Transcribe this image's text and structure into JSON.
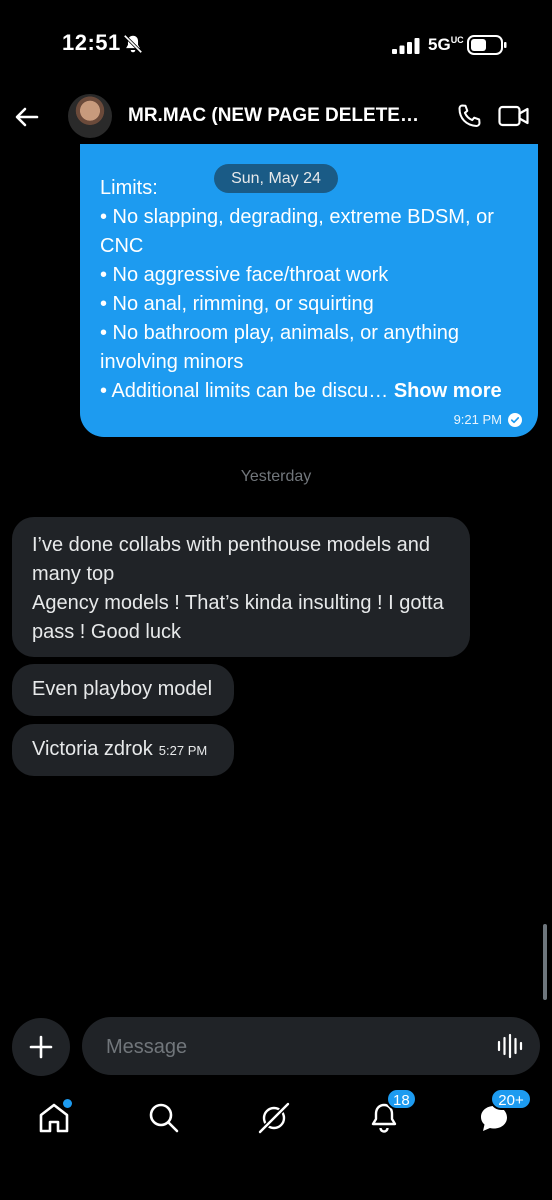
{
  "status_bar": {
    "time": "12:51",
    "network": "5G",
    "network_sup": "UC"
  },
  "header": {
    "contact_name": "MR.MAC (NEW PAGE DELETED...",
    "icons": [
      "back-arrow-icon",
      "phone-icon",
      "video-camera-icon"
    ]
  },
  "messages": {
    "outgoing": {
      "text": "Limits:\n• No slapping, degrading, extreme BDSM, or CNC\n• No aggressive face/throat work\n• No anal, rimming, or squirting\n• No bathroom play, animals, or anything involving minors\n• Additional limits can be discu…",
      "show_more": "Show more",
      "time": "9:21 PM",
      "date_pill": "Sun, May 24"
    },
    "day_separator": "Yesterday",
    "incoming": [
      {
        "text": "I’ve done collabs with penthouse models and many top\nAgency models ! That’s kinda insulting ! I gotta pass ! Good luck"
      },
      {
        "text": "Even playboy model"
      },
      {
        "text": "Victoria zdrok",
        "time": "5:27 PM"
      }
    ]
  },
  "composer": {
    "placeholder": "Message"
  },
  "nav": {
    "notifications_badge": "18",
    "messages_badge": "20+"
  },
  "colors": {
    "accent": "#1d9bf0",
    "incoming_bubble": "#202327",
    "background": "#000000"
  }
}
